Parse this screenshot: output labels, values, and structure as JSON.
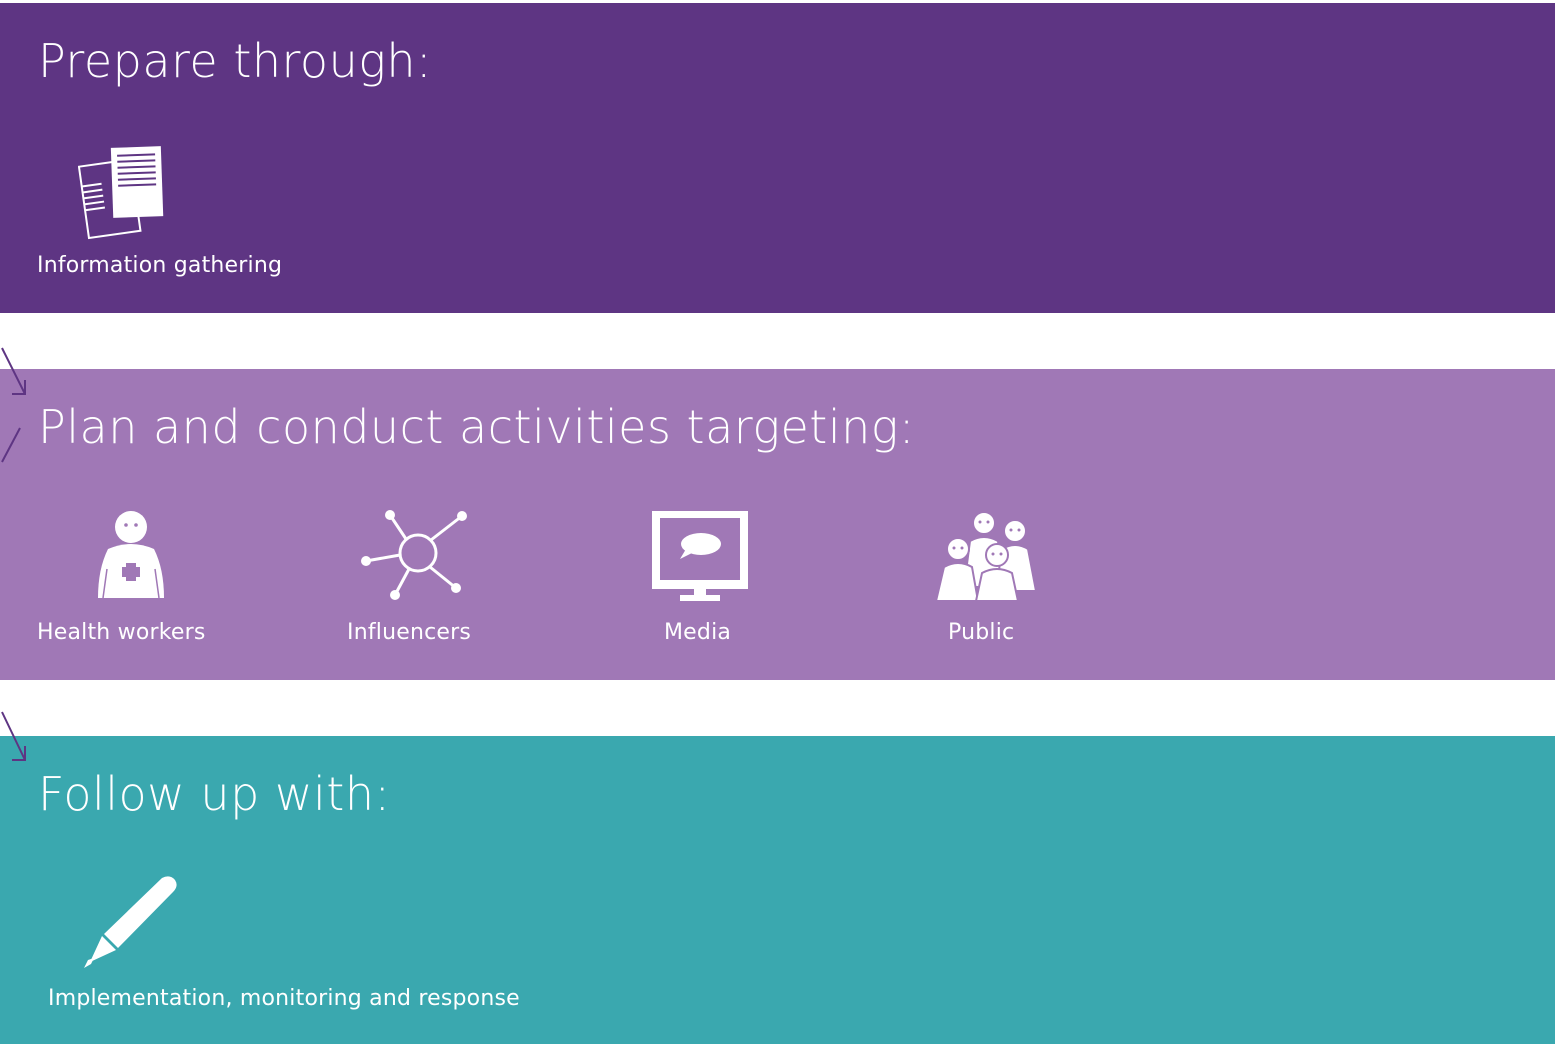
{
  "colors": {
    "prepare_band": "#5e3583",
    "plan_band": "#a078b6",
    "followup_band": "#3aa8af",
    "arrow": "#5e3583",
    "text": "#ffffff"
  },
  "sections": [
    {
      "title": "Prepare through:",
      "items": [
        {
          "label": "Information gathering",
          "icon": "documents-icon"
        }
      ]
    },
    {
      "title": "Plan and conduct activities targeting:",
      "items": [
        {
          "label": "Health workers",
          "icon": "health-worker-icon"
        },
        {
          "label": "Influencers",
          "icon": "network-icon"
        },
        {
          "label": "Media",
          "icon": "monitor-icon"
        },
        {
          "label": "Public",
          "icon": "people-group-icon"
        }
      ]
    },
    {
      "title": "Follow up with:",
      "items": [
        {
          "label": "Implementation, monitoring and response",
          "icon": "pencil-icon"
        }
      ]
    }
  ]
}
